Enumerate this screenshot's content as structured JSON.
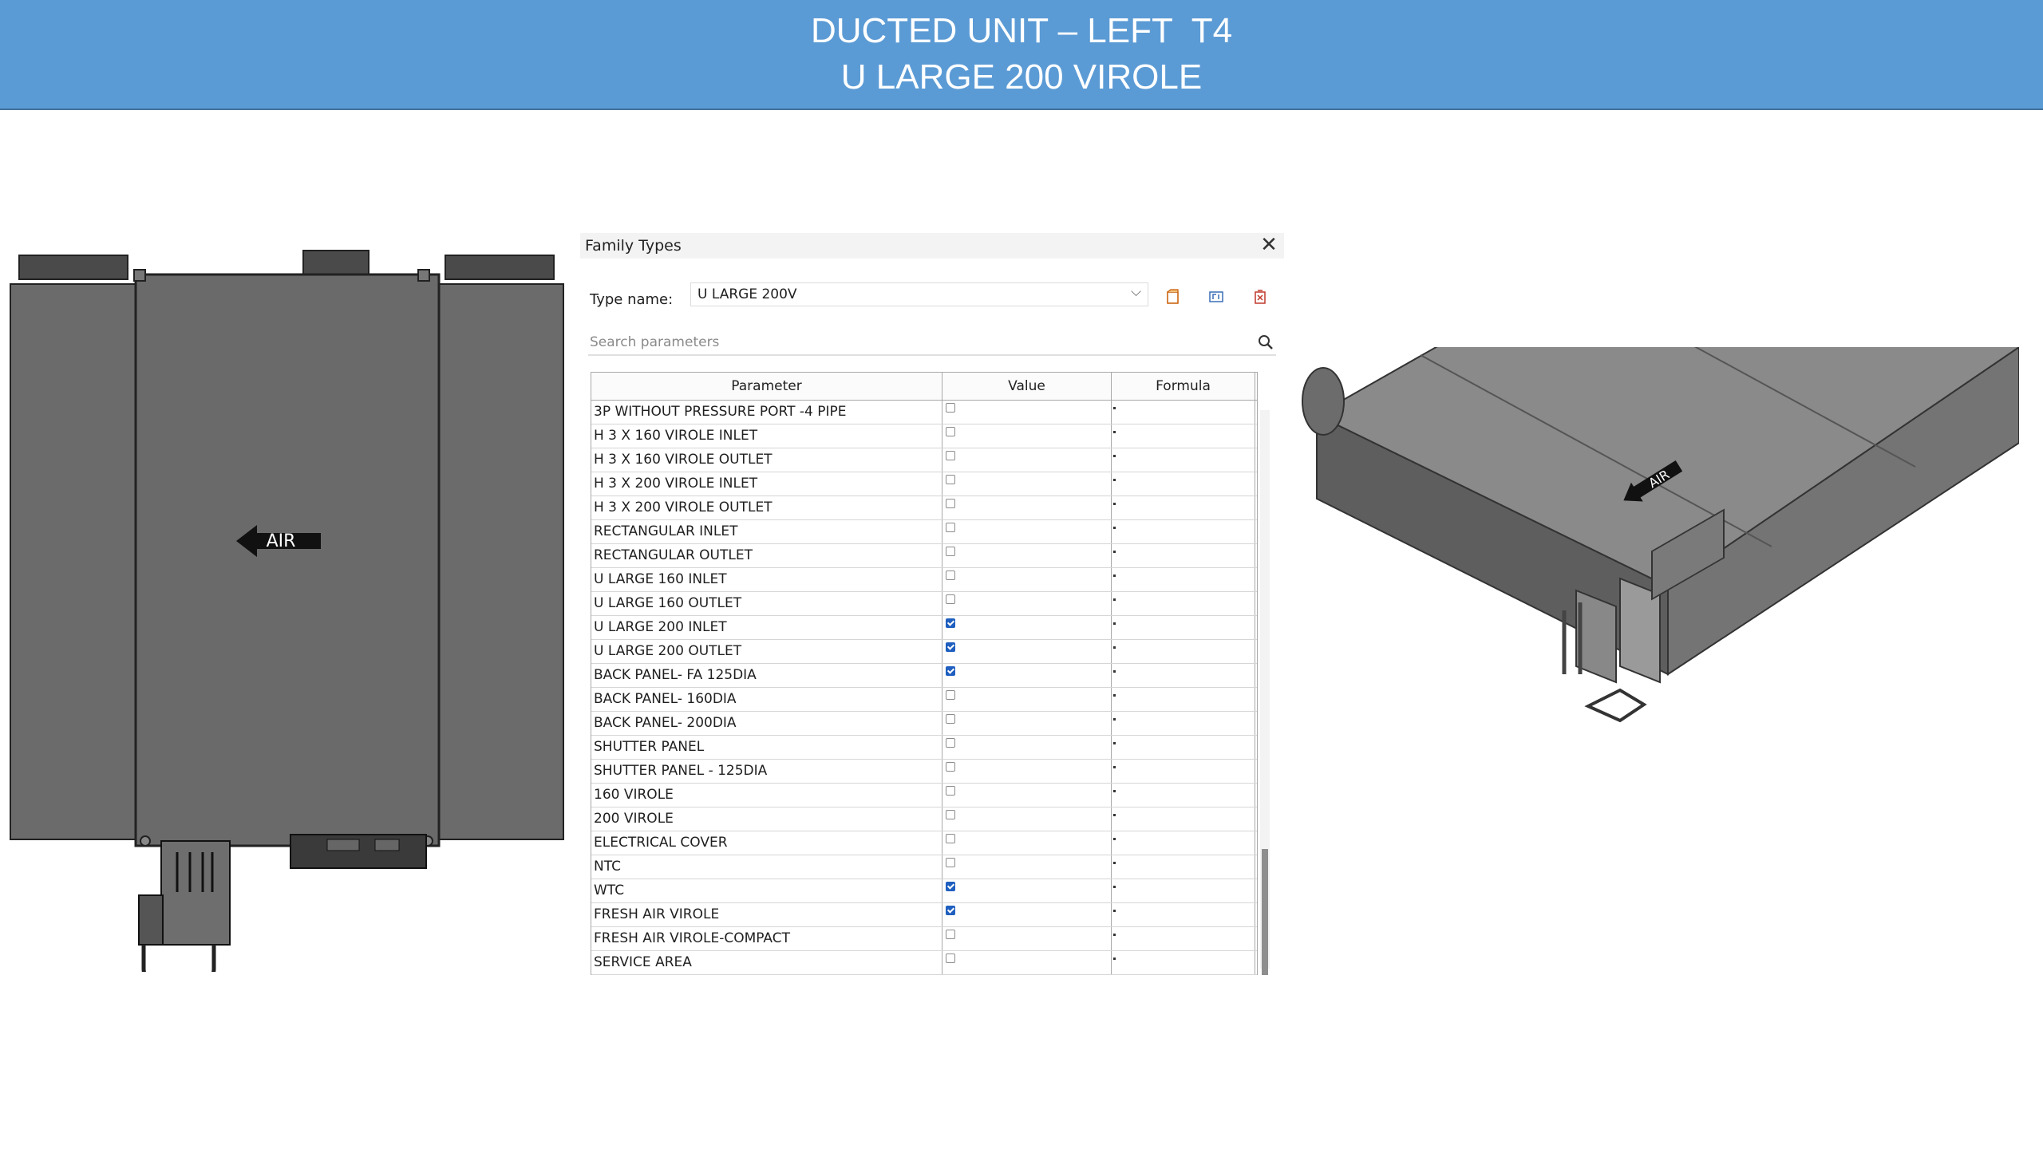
{
  "slide": {
    "title_line1": "DUCTED UNIT – LEFT  T4",
    "title_line2": "U LARGE 200 VIROLE",
    "banner_color": "#5b9bd5"
  },
  "front_view": {
    "air_label": "AIR"
  },
  "iso_view": {
    "air_label": "AIR"
  },
  "dialog": {
    "title": "Family Types",
    "type_name_label": "Type name:",
    "type_name_value": "U LARGE 200V",
    "search_placeholder": "Search parameters",
    "columns": {
      "parameter": "Parameter",
      "value": "Value",
      "formula": "Formula"
    },
    "rows": [
      {
        "name": "3P WITHOUT PRESSURE PORT -4  PIPE",
        "checked": false
      },
      {
        "name": "H  3 X 160 VIROLE INLET",
        "checked": false
      },
      {
        "name": "H  3 X 160 VIROLE OUTLET",
        "checked": false
      },
      {
        "name": "H  3 X 200 VIROLE INLET",
        "checked": false
      },
      {
        "name": "H  3 X 200 VIROLE OUTLET",
        "checked": false
      },
      {
        "name": "RECTANGULAR INLET",
        "checked": false
      },
      {
        "name": "RECTANGULAR OUTLET",
        "checked": false
      },
      {
        "name": "U LARGE 160 INLET",
        "checked": false
      },
      {
        "name": "U LARGE 160 OUTLET",
        "checked": false
      },
      {
        "name": "U LARGE 200 INLET",
        "checked": true
      },
      {
        "name": "U LARGE 200 OUTLET",
        "checked": true
      },
      {
        "name": "BACK PANEL- FA 125DIA",
        "checked": true
      },
      {
        "name": "BACK PANEL- 160DIA",
        "checked": false
      },
      {
        "name": "BACK PANEL- 200DIA",
        "checked": false
      },
      {
        "name": "SHUTTER PANEL",
        "checked": false
      },
      {
        "name": "SHUTTER PANEL - 125DIA",
        "checked": false
      },
      {
        "name": "160 VIROLE",
        "checked": false
      },
      {
        "name": "200 VIROLE",
        "checked": false
      },
      {
        "name": "ELECTRICAL COVER",
        "checked": false
      },
      {
        "name": "NTC",
        "checked": false
      },
      {
        "name": "WTC",
        "checked": true
      },
      {
        "name": "FRESH AIR VIROLE",
        "checked": true
      },
      {
        "name": "FRESH AIR VIROLE-COMPACT",
        "checked": false
      },
      {
        "name": "SERVICE AREA",
        "checked": false
      }
    ]
  }
}
